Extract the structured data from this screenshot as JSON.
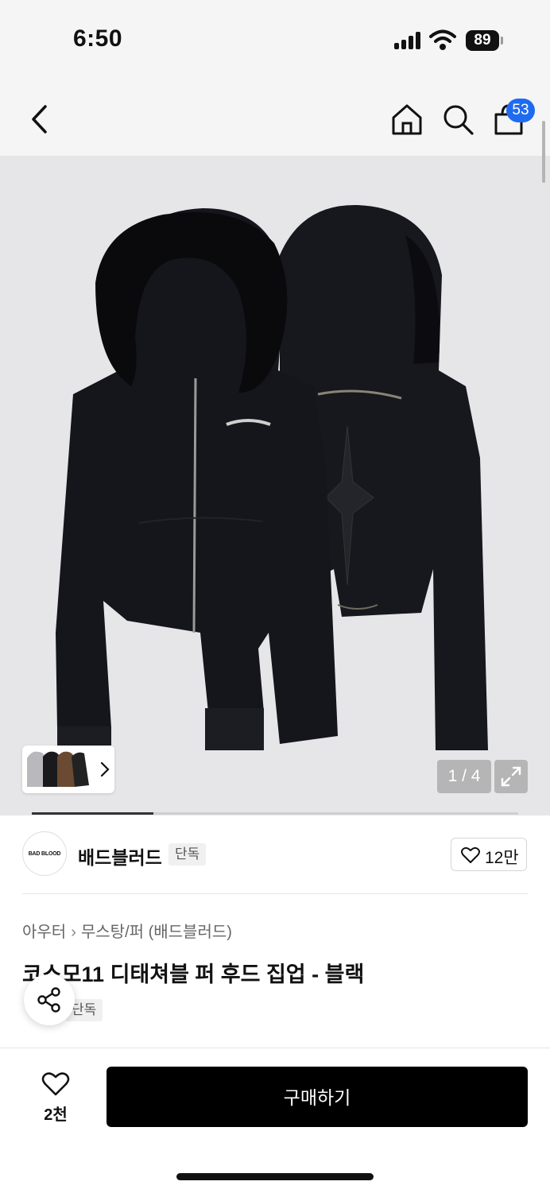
{
  "status": {
    "time": "6:50",
    "battery": "89"
  },
  "nav": {
    "cart_count": "53"
  },
  "gallery": {
    "page_indicator": "1 / 4",
    "current_page": 1,
    "total_pages": 4,
    "progress": 0.25
  },
  "brand": {
    "logo_text": "BAD BLOOD",
    "name": "배드블러드",
    "badge": "단독",
    "likes": "12만"
  },
  "product": {
    "breadcrumb": [
      "아우터",
      "무스탕/퍼 (배드블러드)"
    ],
    "title": "코스모11 디태쳐블 퍼 후드 집업 - 블랙",
    "tag": "단독"
  },
  "bottom": {
    "wish_count": "2천",
    "buy_label": "구매하기"
  },
  "colors": {
    "accent": "#1f6bf0",
    "buy_button": "#000000",
    "image_bg": "#e6e6e8"
  }
}
